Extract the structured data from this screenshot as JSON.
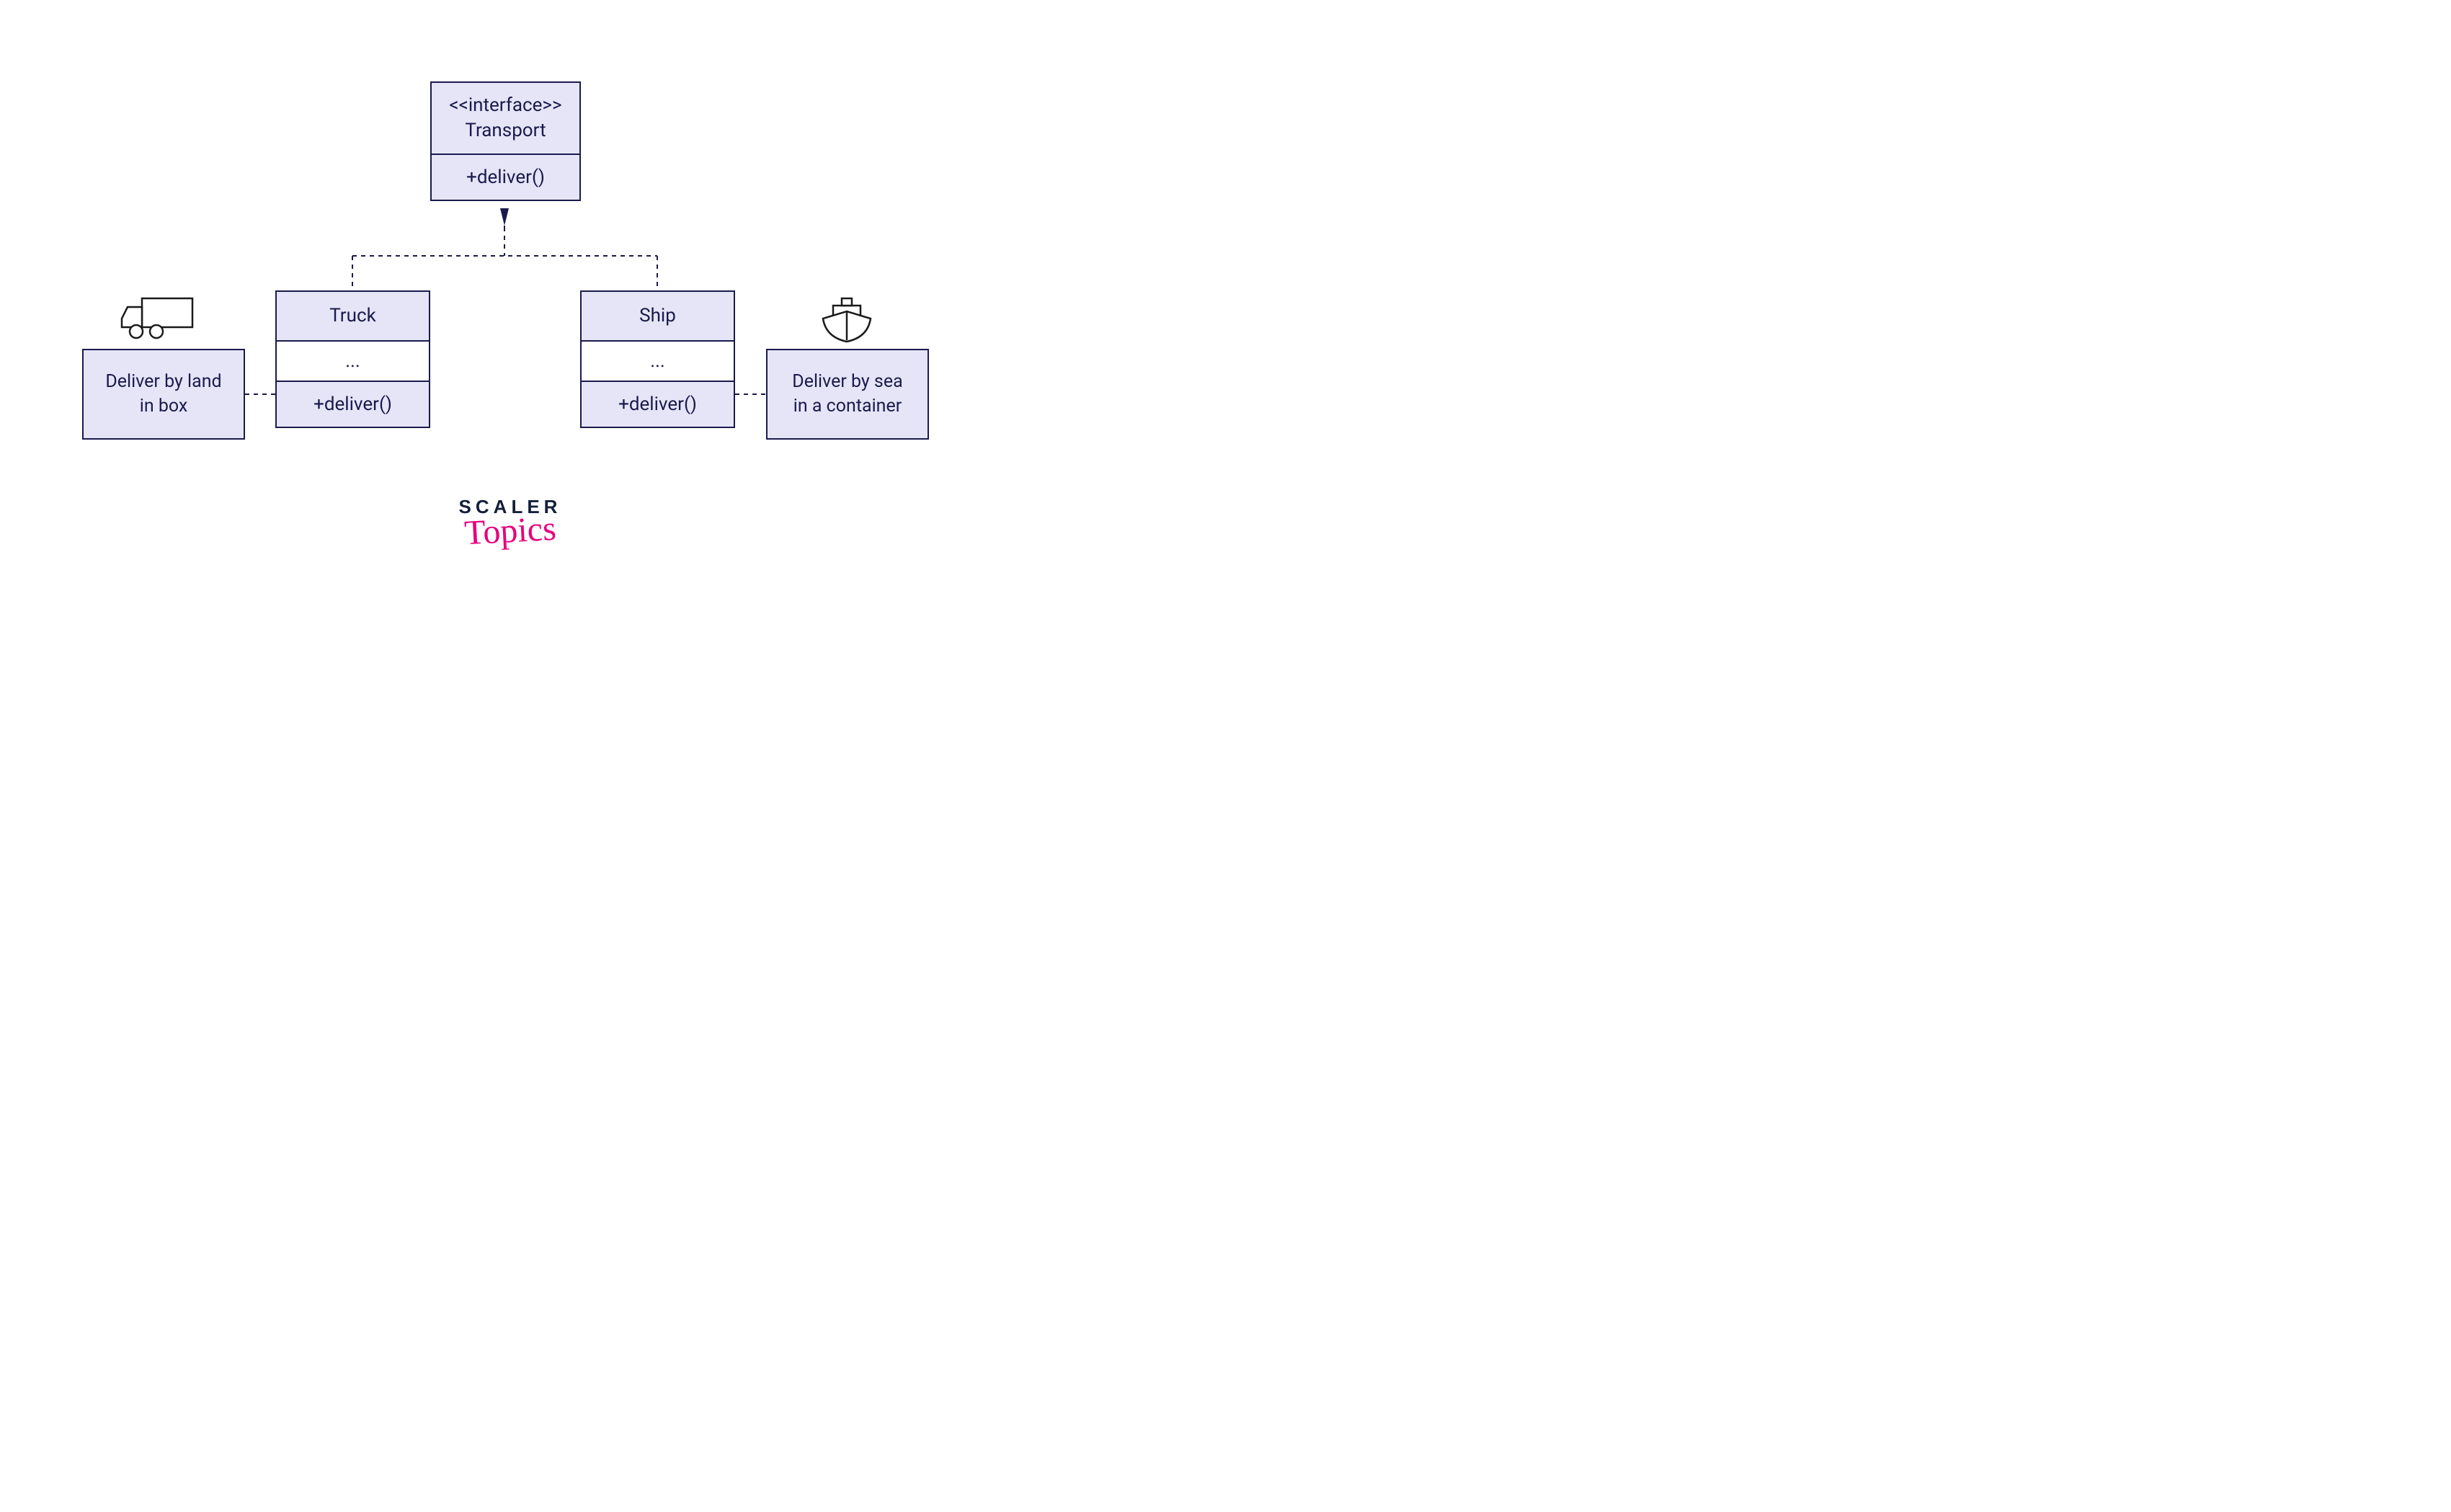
{
  "interface": {
    "stereotype": "<<interface>>",
    "name": "Transport",
    "method": "+deliver()"
  },
  "truck": {
    "name": "Truck",
    "mid": "...",
    "method": "+deliver()",
    "note": "Deliver by land\nin box"
  },
  "ship": {
    "name": "Ship",
    "mid": "...",
    "method": "+deliver()",
    "note": "Deliver by sea\nin a container"
  },
  "logo": {
    "top": "SCALER",
    "bottom": "Topics"
  },
  "colors": {
    "boxFill": "#e5e5f7",
    "border": "#1a1a4d",
    "accent": "#e6007e"
  }
}
